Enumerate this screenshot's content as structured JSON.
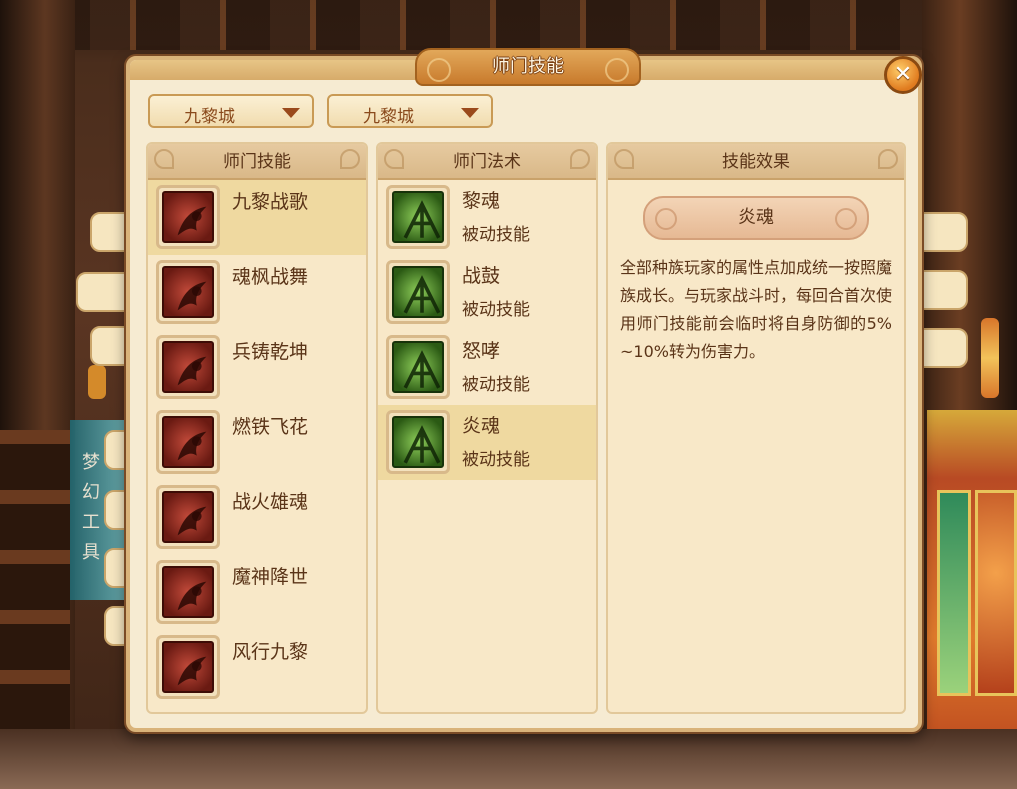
{
  "dialog": {
    "title": "师门技能",
    "close_label": "✕"
  },
  "filters": {
    "left_dropdown": "九黎城",
    "right_dropdown": "九黎城"
  },
  "background": {
    "side_banner": [
      "梦",
      "幻",
      "工",
      "具"
    ]
  },
  "skills_panel": {
    "header": "师门技能",
    "items": [
      {
        "name": "九黎战歌",
        "icon": "warrior-song-icon",
        "selected": true
      },
      {
        "name": "魂枫战舞",
        "icon": "spirit-dance-icon",
        "selected": false
      },
      {
        "name": "兵铸乾坤",
        "icon": "forge-icon",
        "selected": false
      },
      {
        "name": "燃铁飞花",
        "icon": "burning-iron-icon",
        "selected": false
      },
      {
        "name": "战火雄魂",
        "icon": "war-fire-icon",
        "selected": false
      },
      {
        "name": "魔神降世",
        "icon": "demon-god-icon",
        "selected": false
      },
      {
        "name": "风行九黎",
        "icon": "wind-icon",
        "selected": false
      }
    ]
  },
  "spells_panel": {
    "header": "师门法术",
    "items": [
      {
        "name": "黎魂",
        "type": "被动技能",
        "icon": "li-soul-icon",
        "selected": false
      },
      {
        "name": "战鼓",
        "type": "被动技能",
        "icon": "war-drum-icon",
        "selected": false
      },
      {
        "name": "怒哮",
        "type": "被动技能",
        "icon": "roar-icon",
        "selected": false
      },
      {
        "name": "炎魂",
        "type": "被动技能",
        "icon": "flame-soul-icon",
        "selected": true
      }
    ]
  },
  "effect_panel": {
    "header": "技能效果",
    "selected_name": "炎魂",
    "description": "全部种族玩家的属性点加成统一按照魔族成长。与玩家战斗时，每回合首次使用师门技能前会临时将自身防御的5%~10%转为伤害力。"
  },
  "colors": {
    "dialog_bg": "#f6ebd2",
    "title_plate": "#c87a2c",
    "selected_row": "#efd9a0",
    "skill_icon_red": "#c24a3a",
    "spell_icon_green": "#8fcf5a",
    "text_brown": "#5a3418"
  }
}
